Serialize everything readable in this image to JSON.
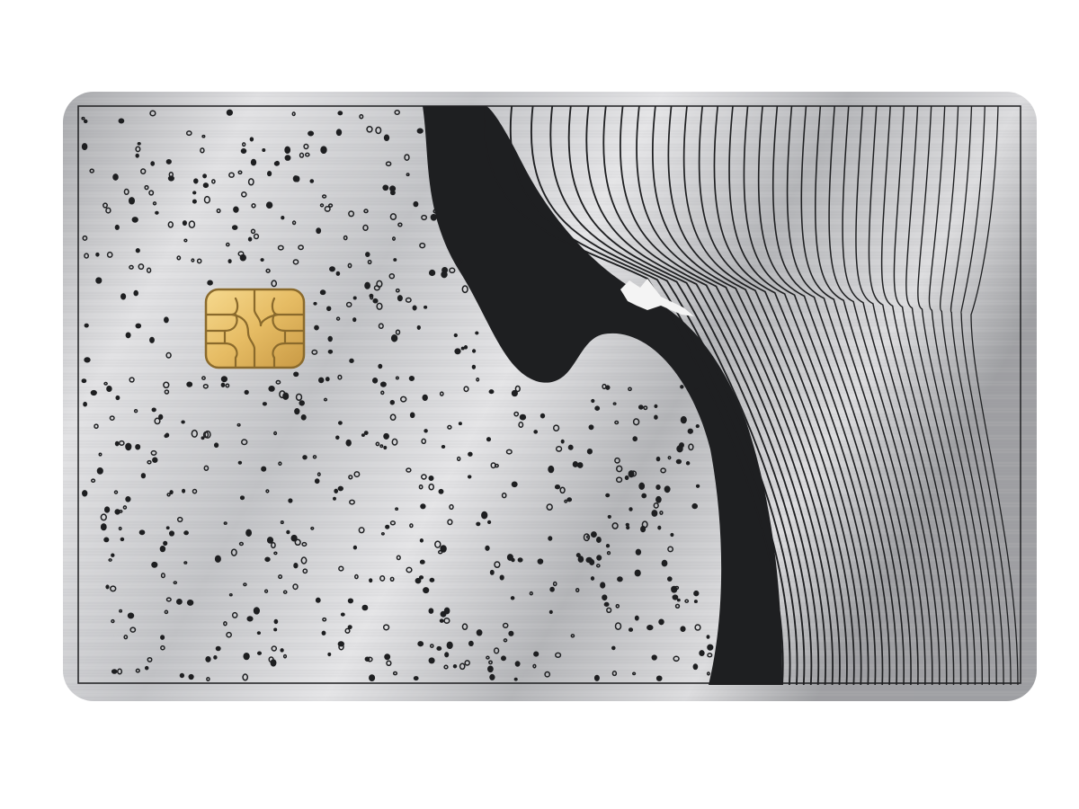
{
  "scene": {
    "subject": "metal-payment-card",
    "text_content": []
  },
  "colors": {
    "background": "#ffffff",
    "metal_light": "#d9d9db",
    "metal_mid": "#b3b4b7",
    "metal_dark": "#8e8f92",
    "ink": "#1e1f21",
    "chip_gold": "#e8c16a",
    "chip_outline": "#8a6a2c"
  },
  "icons": {
    "chip": "emv-chip-icon"
  }
}
